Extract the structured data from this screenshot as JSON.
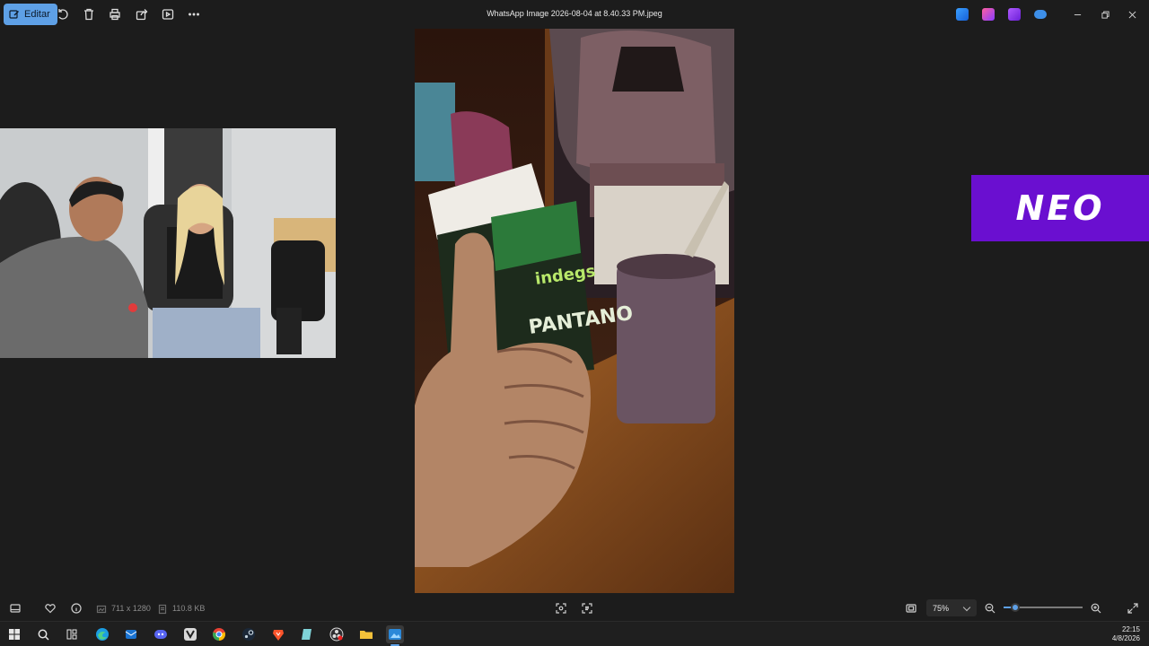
{
  "toolbar": {
    "edit_label": "Editar",
    "title": "WhatsApp Image 2026-08-04 at 8.40.33 PM.jpeg"
  },
  "banner": {
    "text": "NEO"
  },
  "statusbar": {
    "dimensions": "711 x 1280",
    "file_size": "110.8 KB",
    "zoom": "75%",
    "zoom_fraction": 0.15
  },
  "taskbar": {
    "time": "22:15",
    "date": "4/8/2026"
  },
  "colors": {
    "accent": "#5ea0e6",
    "banner": "#6a0fd0",
    "background": "#1c1c1c"
  }
}
